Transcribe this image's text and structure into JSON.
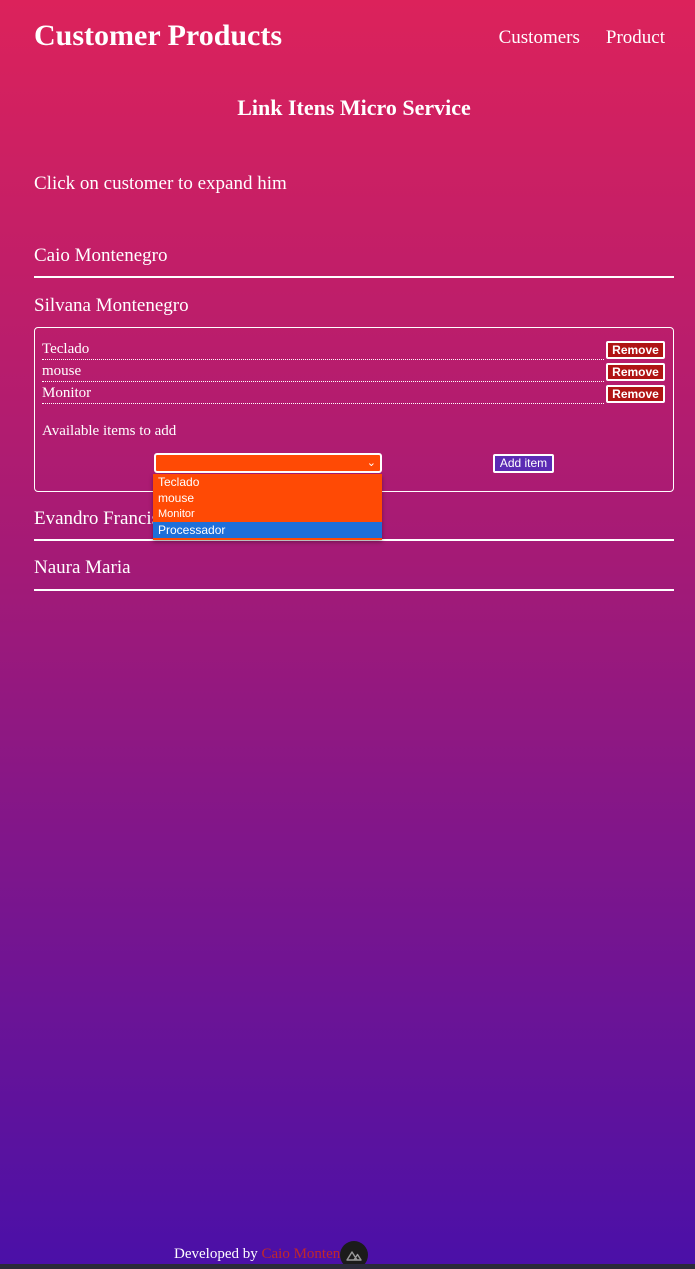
{
  "header": {
    "title": "Customer Products",
    "nav": [
      "Customers",
      "Product"
    ]
  },
  "subtitle": "Link Itens Micro Service",
  "hint": "Click on customer to expand him",
  "customers": [
    {
      "name": "Caio Montenegro"
    },
    {
      "name": "Silvana Montenegro",
      "expanded": true,
      "items": [
        {
          "label": "Teclado",
          "action": "Remove"
        },
        {
          "label": "mouse",
          "action": "Remove"
        },
        {
          "label": "Monitor",
          "action": "Remove"
        }
      ],
      "available_label": "Available items to add",
      "select": {
        "value": "",
        "options": [
          "Teclado",
          "mouse",
          "Monitor",
          "Processador"
        ],
        "highlighted": "Processador"
      },
      "add_button": "Add item"
    },
    {
      "name": "Evandro Francis"
    },
    {
      "name": "Naura Maria"
    }
  ],
  "footer": {
    "prefix": "Developed by",
    "author": "Caio Monten"
  },
  "colors": {
    "gradient_top": "#dc225b",
    "gradient_bottom": "#4a10a8",
    "remove_button": "#b01414",
    "select_bg": "#ff4a05",
    "option_highlight": "#1e6fd9",
    "add_button": "#5b2bb4",
    "author_link": "#c0282a"
  },
  "icons": {
    "select_chevron": "chevron-down-icon",
    "floating_button": "nuxt-logo-icon"
  }
}
